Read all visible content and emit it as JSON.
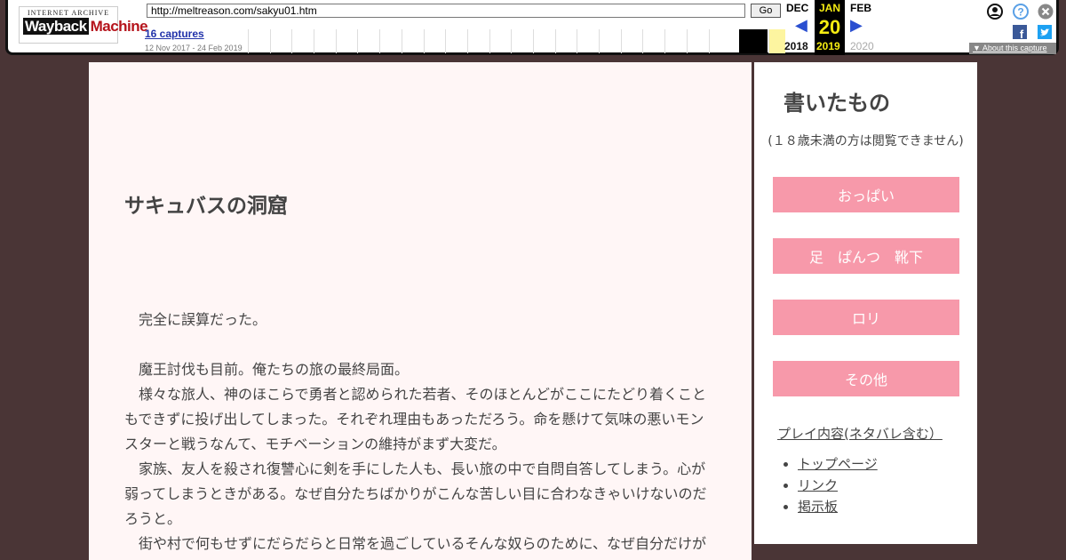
{
  "wayback": {
    "logo_top": "INTERNET ARCHIVE",
    "logo_main_a": "Wayback",
    "logo_main_b": "Machine",
    "url": "http://meltreason.com/sakyu01.htm",
    "go_label": "Go",
    "captures": "16 captures",
    "date_range": "12 Nov 2017 - 24 Feb 2019",
    "prev_month": "DEC",
    "cur_month": "JAN",
    "next_month": "FEB",
    "cur_day": "20",
    "prev_year": "2018",
    "cur_year": "2019",
    "next_year": "2020",
    "about": "About this capture",
    "accent": "#2a4fd0",
    "highlight": "#f5ec12"
  },
  "page": {
    "title": "サキュバスの洞窟",
    "paragraphs": [
      "完全に誤算だった。",
      "魔王討伐も目前。俺たちの旅の最終局面。",
      "様々な旅人、神のほこらで勇者と認められた若者、そのほとんどがここにたどり着くこともできずに投げ出してしまった。それぞれ理由もあっただろう。命を懸けて気味の悪いモンスターと戦うなんて、モチベーションの維持がまず大変だ。",
      "家族、友人を殺され復讐心に剣を手にした人も、長い旅の中で自問自答してしまう。心が弱ってしまうときがある。なぜ自分たちばかりがこんな苦しい目に合わなきゃいけないのだろうと。",
      "街や村で何もせずにだらだらと日常を過ごしているそんな奴らのために、なぜ自分だけが"
    ]
  },
  "sidebar": {
    "heading": "書いたもの",
    "note": "(１８歳未満の方は閲覧できません)",
    "buttons": [
      "おっぱい",
      "足　ぱんつ　靴下",
      "ロリ",
      "その他"
    ],
    "play_link": "プレイ内容(ネタバレ含む）",
    "links": [
      "トップページ",
      "リンク",
      "掲示板"
    ],
    "button_color": "#f799aa"
  }
}
